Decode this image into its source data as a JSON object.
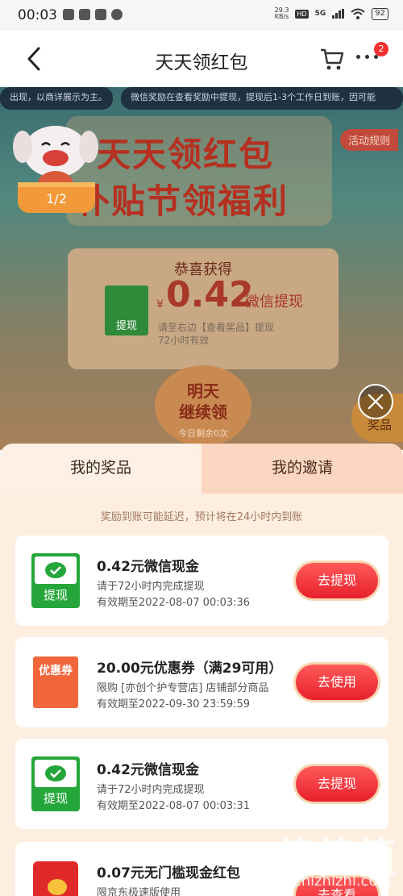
{
  "status_bar": {
    "time": "00:03",
    "net_speed_value": "29.3",
    "net_speed_unit": "KB/s",
    "hd": "HD",
    "network": "5G",
    "battery": "92"
  },
  "nav": {
    "title": "天天领红包",
    "badge": "2"
  },
  "event": {
    "marquee": [
      "出现，以商详展示为主。",
      "微信奖励在查看奖励中提现，提现后1-3个工作日到账，因可能"
    ],
    "rules_label": "活动规则",
    "hero_line1": "天天领红包",
    "hero_line2": "补贴节领福利",
    "mascot_progress": "1/2",
    "prize_title": "恭喜获得",
    "prize_currency": "¥",
    "prize_amount": "0.42",
    "prize_type": "微信提现",
    "prize_icon_label": "提现",
    "prize_note_line1": "请至右边【查看奖品】提现",
    "prize_note_line2": "72小时有效",
    "continue_line1": "明天",
    "continue_line2": "继续领",
    "continue_sub": "今日剩余0次",
    "side_label": "奖品"
  },
  "sheet": {
    "tabs": [
      {
        "label": "我的奖品",
        "selected": true
      },
      {
        "label": "我的邀请",
        "selected": false
      }
    ],
    "notice": "奖励到账可能延迟，预计将在24小时内到账",
    "items": [
      {
        "icon": "wechat-cash-icon",
        "icon_label": "提现",
        "title": "0.42元微信现金",
        "subtitle": "请于72小时内完成提现",
        "expiry": "有效期至2022-08-07 00:03:36",
        "button": "去提现"
      },
      {
        "icon": "coupon-icon",
        "icon_label": "优惠券",
        "title": "20.00元优惠券（满29可用）",
        "subtitle": "限购 [亦创个护专营店] 店铺部分商品",
        "expiry": "有效期至2022-09-30 23:59:59",
        "button": "去使用"
      },
      {
        "icon": "wechat-cash-icon",
        "icon_label": "提现",
        "title": "0.42元微信现金",
        "subtitle": "请于72小时内完成提现",
        "expiry": "有效期至2022-08-07 00:03:31",
        "button": "去提现"
      },
      {
        "icon": "red-packet-icon",
        "icon_label": "",
        "title": "0.07元无门槛现金红包",
        "subtitle": "限京东极速版使用",
        "expiry": "",
        "button": "去查看"
      }
    ]
  },
  "watermark": {
    "text": "值值值",
    "url": "zhizhizhi.com"
  },
  "colors": {
    "accent_red": "#e8202c",
    "wechat_green": "#25a63b",
    "sheet_bg": "#fdeee0"
  }
}
